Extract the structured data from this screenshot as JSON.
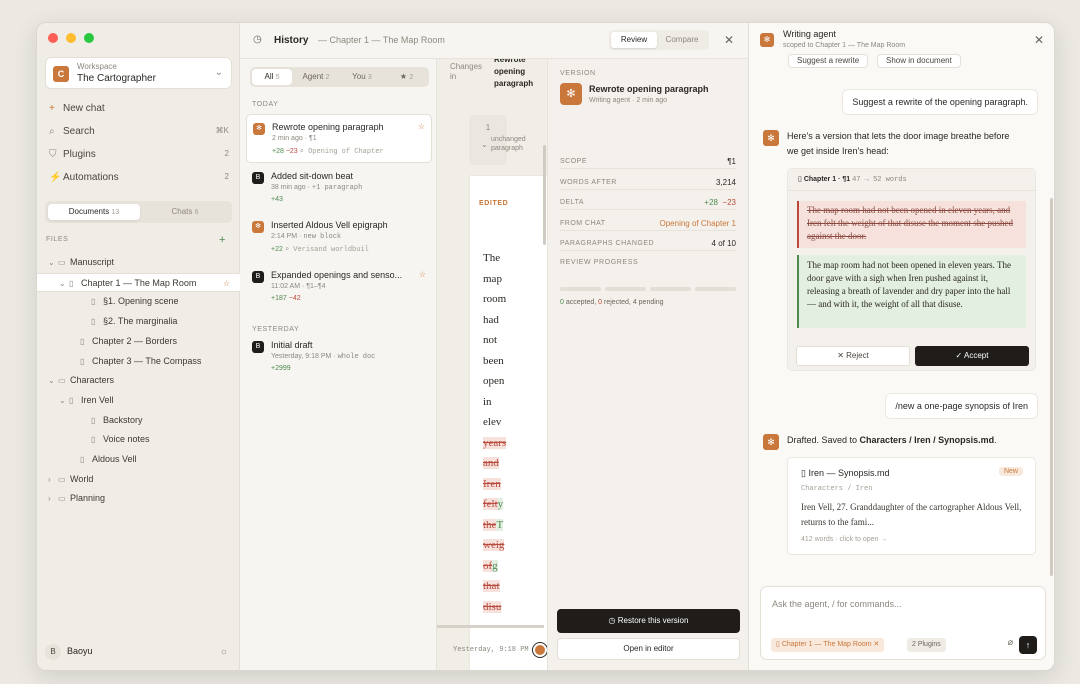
{
  "window": {
    "title_dots": [
      "#ff5f57",
      "#febc2e",
      "#28c840"
    ]
  },
  "sidebar": {
    "workspace_label": "Workspace",
    "workspace_name": "The Cartographer",
    "workspace_initial": "C",
    "nav": [
      {
        "label": "New chat",
        "icon": "+",
        "count": ""
      },
      {
        "label": "Search",
        "icon": "⌕",
        "count": "⌘K"
      },
      {
        "label": "Plugins",
        "icon": "⛉",
        "count": "2"
      },
      {
        "label": "Automations",
        "icon": "⚡",
        "count": "2"
      }
    ],
    "tabs": [
      {
        "label": "Documents",
        "count": "13"
      },
      {
        "label": "Chats",
        "count": "6"
      }
    ],
    "files_header": "FILES",
    "tree": [
      {
        "label": "Manuscript",
        "indent": 0,
        "caret": "⌄",
        "type": "folder"
      },
      {
        "label": "Chapter 1 — The Map Room",
        "indent": 1,
        "caret": "⌄",
        "type": "file",
        "selected": true,
        "star": "☆"
      },
      {
        "label": "§1. Opening scene",
        "indent": 3,
        "caret": "",
        "type": "file"
      },
      {
        "label": "§2. The marginalia",
        "indent": 3,
        "caret": "",
        "type": "file"
      },
      {
        "label": "Chapter 2 — Borders",
        "indent": 2,
        "caret": "",
        "type": "file"
      },
      {
        "label": "Chapter 3 — The Compass",
        "indent": 2,
        "caret": "",
        "type": "file"
      },
      {
        "label": "Characters",
        "indent": 0,
        "caret": "⌄",
        "type": "folder"
      },
      {
        "label": "Iren Vell",
        "indent": 1,
        "caret": "⌄",
        "type": "file"
      },
      {
        "label": "Backstory",
        "indent": 3,
        "caret": "",
        "type": "file"
      },
      {
        "label": "Voice notes",
        "indent": 3,
        "caret": "",
        "type": "file"
      },
      {
        "label": "Aldous Vell",
        "indent": 2,
        "caret": "",
        "type": "file"
      },
      {
        "label": "World",
        "indent": 0,
        "caret": "›",
        "type": "folder"
      },
      {
        "label": "Planning",
        "indent": 0,
        "caret": "›",
        "type": "folder"
      }
    ],
    "user": {
      "initial": "B",
      "name": "Baoyu"
    }
  },
  "history": {
    "title": "History",
    "subtitle": "— Chapter 1 — The Map Room",
    "review_label": "Review",
    "compare_label": "Compare",
    "filters": [
      {
        "label": "All",
        "count": "5"
      },
      {
        "label": "Agent",
        "count": "2"
      },
      {
        "label": "You",
        "count": "3"
      },
      {
        "label": "★",
        "count": "2"
      }
    ],
    "today_label": "TODAY",
    "yesterday_label": "YESTERDAY",
    "versions": [
      {
        "name": "Rewrote opening paragraph",
        "time": "2 min ago",
        "scope": "¶1",
        "plus": "+28",
        "minus": "−23",
        "note": "Opening of Chapter",
        "badge": "✻",
        "badge_color": "#c9773a",
        "pinned": "☆"
      },
      {
        "name": "Added sit-down beat",
        "time": "38 min ago",
        "scope": "+1 paragraph",
        "plus": "+43",
        "minus": "",
        "note": "",
        "badge": "B",
        "badge_color": "#1f1c19",
        "pinned": ""
      },
      {
        "name": "Inserted Aldous Vell epigraph",
        "time": "2:14 PM",
        "scope": "new block",
        "plus": "+22",
        "minus": "",
        "note": "Verisand worldbuil",
        "badge": "✻",
        "badge_color": "#c9773a",
        "pinned": ""
      },
      {
        "name": "Expanded openings and senso...",
        "time": "11:02 AM",
        "scope": "¶1–¶4",
        "plus": "+187",
        "minus": "−42",
        "note": "",
        "badge": "B",
        "badge_color": "#1f1c19",
        "pinned": "☆"
      },
      {
        "name": "Initial draft",
        "time": "Yesterday, 9:18 PM",
        "scope": "whole doc",
        "plus": "+2999",
        "minus": "",
        "note": "",
        "badge": "B",
        "badge_color": "#1f1c19",
        "pinned": ""
      }
    ],
    "changes": {
      "header_left": "Changes in",
      "header_title": "Rewrote opening paragraph",
      "unchanged_count": "1",
      "unchanged_label": "unchanged paragraph",
      "edited_label": "EDITED",
      "lines": [
        {
          "text": "The",
          "kind": "plain"
        },
        {
          "text": "map",
          "kind": "plain"
        },
        {
          "text": "room",
          "kind": "plain"
        },
        {
          "text": "had",
          "kind": "plain"
        },
        {
          "text": "not",
          "kind": "plain"
        },
        {
          "text": "been",
          "kind": "plain"
        },
        {
          "text": "open",
          "kind": "plain"
        },
        {
          "text": "in",
          "kind": "plain"
        },
        {
          "text": "elev",
          "kind": "plain"
        },
        {
          "text": "years",
          "kind": "del"
        },
        {
          "text": "and",
          "kind": "del"
        },
        {
          "text": "Iren",
          "kind": "del"
        },
        {
          "text": "felt",
          "kind": "del",
          "tail": "y"
        },
        {
          "text": "the",
          "kind": "del",
          "tail": "T"
        },
        {
          "text": "weig",
          "kind": "del"
        },
        {
          "text": "of",
          "kind": "del",
          "tail": "g"
        },
        {
          "text": "that",
          "kind": "del"
        },
        {
          "text": "disu",
          "kind": "del"
        }
      ],
      "timestamp": "Yesterday, 9:18 PM"
    },
    "details": {
      "version_label": "VERSION",
      "name": "Rewrote opening paragraph",
      "meta": "Writing agent · 2 min ago",
      "rows": [
        {
          "key": "SCOPE",
          "value": "¶1",
          "kind": "plain"
        },
        {
          "key": "WORDS AFTER",
          "value": "3,214",
          "kind": "plain"
        },
        {
          "key": "DELTA",
          "value": "+28  −23",
          "kind": "delta"
        },
        {
          "key": "FROM CHAT",
          "value": "Opening of Chapter 1",
          "kind": "link"
        },
        {
          "key": "PARAGRAPHS CHANGED",
          "value": "4 of 10",
          "kind": "plain"
        }
      ],
      "review_progress_label": "REVIEW PROGRESS",
      "review_counts": {
        "accepted": "0",
        "rejected": "0",
        "pending": "4"
      },
      "review_text_accepted": "accepted,",
      "review_text_rejected": "rejected, 4 pending",
      "restore_label": "Restore this version",
      "open_label": "Open in editor"
    }
  },
  "agent": {
    "title": "Writing agent",
    "scope": "scoped to Chapter 1 — The Map Room",
    "top_pills": [
      "Suggest a rewrite",
      "Show in document"
    ],
    "msg1": "Suggest a rewrite of the opening paragraph.",
    "reply1": "Here's a version that lets the door image breathe before we get inside Iren's head:",
    "diff": {
      "header": "Chapter 1 · ¶1",
      "words": "47 → 52 words",
      "old": "The map room had not been opened in eleven years, and Iren felt the weight of that disuse the moment she pushed against the door.",
      "new": "The map room had not been opened in eleven years. The door gave with a sigh when Iren pushed against it, releasing a breath of lavender and dry paper into the hall — and with it, the weight of all that disuse.",
      "reject": "Reject",
      "accept": "Accept"
    },
    "msg2": "/new a one-page synopsis of Iren",
    "reply2_prefix": "Drafted. Saved to ",
    "reply2_path": "Characters / Iren / Synopsis.md",
    "reply2_suffix": ".",
    "file": {
      "name": "Iren — Synopsis.md",
      "badge": "New",
      "path": "Characters / Iren",
      "body": "Iren Vell, 27. Granddaughter of the cartographer Aldous Vell, returns to the fami...",
      "footer": "412 words · click to open →"
    },
    "input_placeholder": "Ask the agent, / for commands...",
    "context_chip": "Chapter 1 — The Map Room",
    "plugins_chip": "2 Plugins",
    "colors": {
      "accent": "#c9773a",
      "dark": "#1f1c19",
      "add": "#4c8a4f",
      "remove": "#b94a3d"
    }
  }
}
